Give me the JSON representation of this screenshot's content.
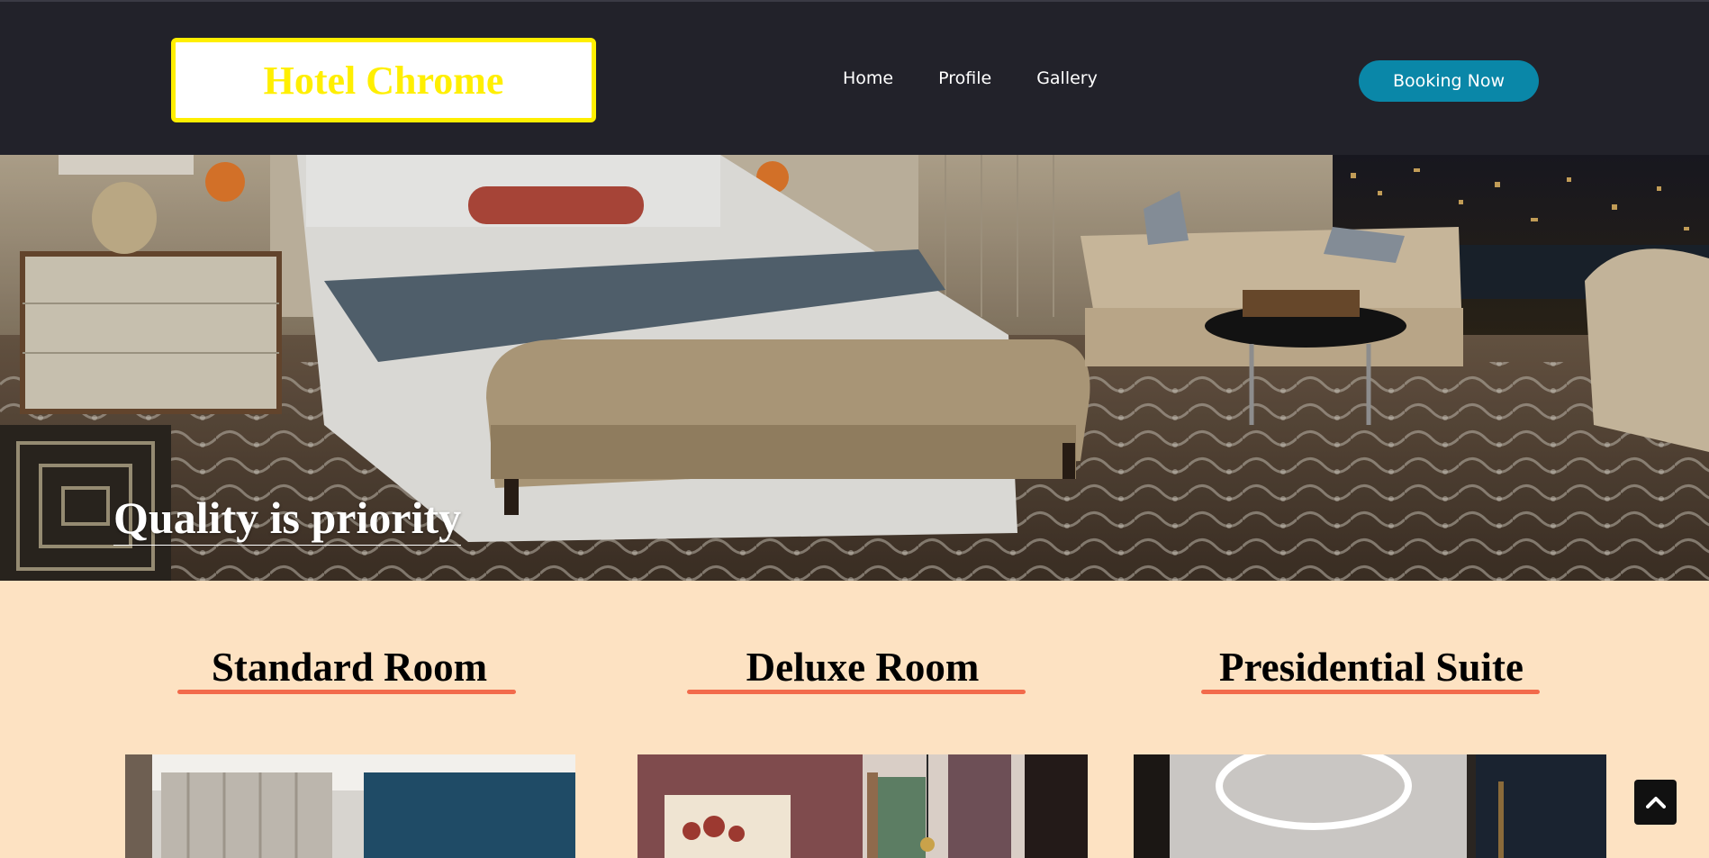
{
  "header": {
    "logo_text": "Hotel Chrome",
    "nav": [
      {
        "label": "Home"
      },
      {
        "label": "Profile"
      },
      {
        "label": "Gallery"
      }
    ],
    "booking_label": "Booking Now"
  },
  "hero": {
    "title": "Quality is priority"
  },
  "rooms": [
    {
      "title": "Standard Room"
    },
    {
      "title": "Deluxe Room"
    },
    {
      "title": "Presidential Suite"
    }
  ],
  "icons": {
    "scroll_top": "chevron-up-icon"
  },
  "colors": {
    "header_bg": "#22222a",
    "logo_border": "#ffef00",
    "booking_button": "#0a87a8",
    "page_bg": "#fde2c2",
    "heading_underline": "#f26a4b"
  }
}
